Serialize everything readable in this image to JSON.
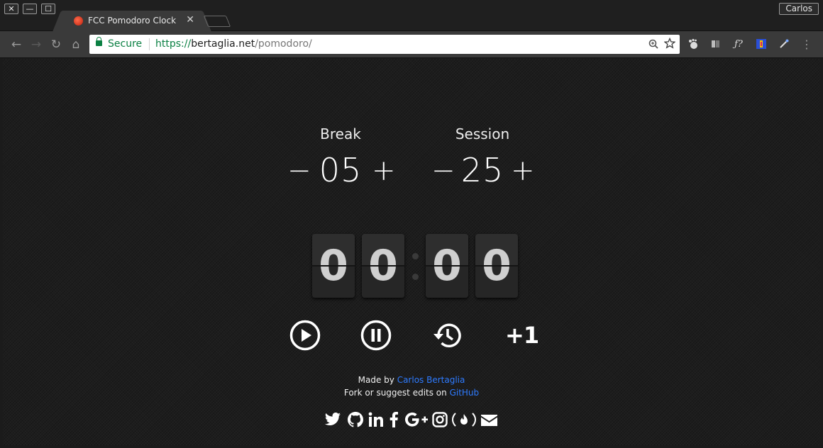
{
  "window": {
    "close_glyph": "✕",
    "minimize_glyph": "—",
    "maximize_glyph": "☐",
    "profile_label": "Carlos"
  },
  "tab": {
    "title": "FCC Pomodoro Clock",
    "close_glyph": "✕"
  },
  "toolbar": {
    "back_glyph": "←",
    "forward_glyph": "→",
    "reload_glyph": "↻",
    "home_glyph": "⌂",
    "secure_label": "Secure",
    "url_protocol": "https://",
    "url_host": "bertaglia.net",
    "url_path": "/pomodoro/",
    "menu_glyph": "⋮"
  },
  "pomodoro": {
    "break_label": "Break",
    "break_value": "05",
    "session_label": "Session",
    "session_value": "25",
    "minus_glyph": "−",
    "plus_glyph": "+",
    "clock_digits": [
      "0",
      "0",
      "0",
      "0"
    ],
    "plus_one_label": "+1"
  },
  "footer": {
    "made_by_prefix": "Made by ",
    "author_name": "Carlos Bertaglia",
    "fork_prefix": "Fork or suggest edits on ",
    "github_link": "GitHub"
  },
  "social_icons": [
    "twitter-icon",
    "github-icon",
    "linkedin-icon",
    "facebook-icon",
    "google-plus-icon",
    "instagram-icon",
    "freecodecamp-icon",
    "email-icon"
  ],
  "colors": {
    "secure_green": "#0b8043",
    "link_blue": "#2e7bff",
    "page_bg": "#1d1d1d",
    "flip_card": "#2e2e2e"
  }
}
